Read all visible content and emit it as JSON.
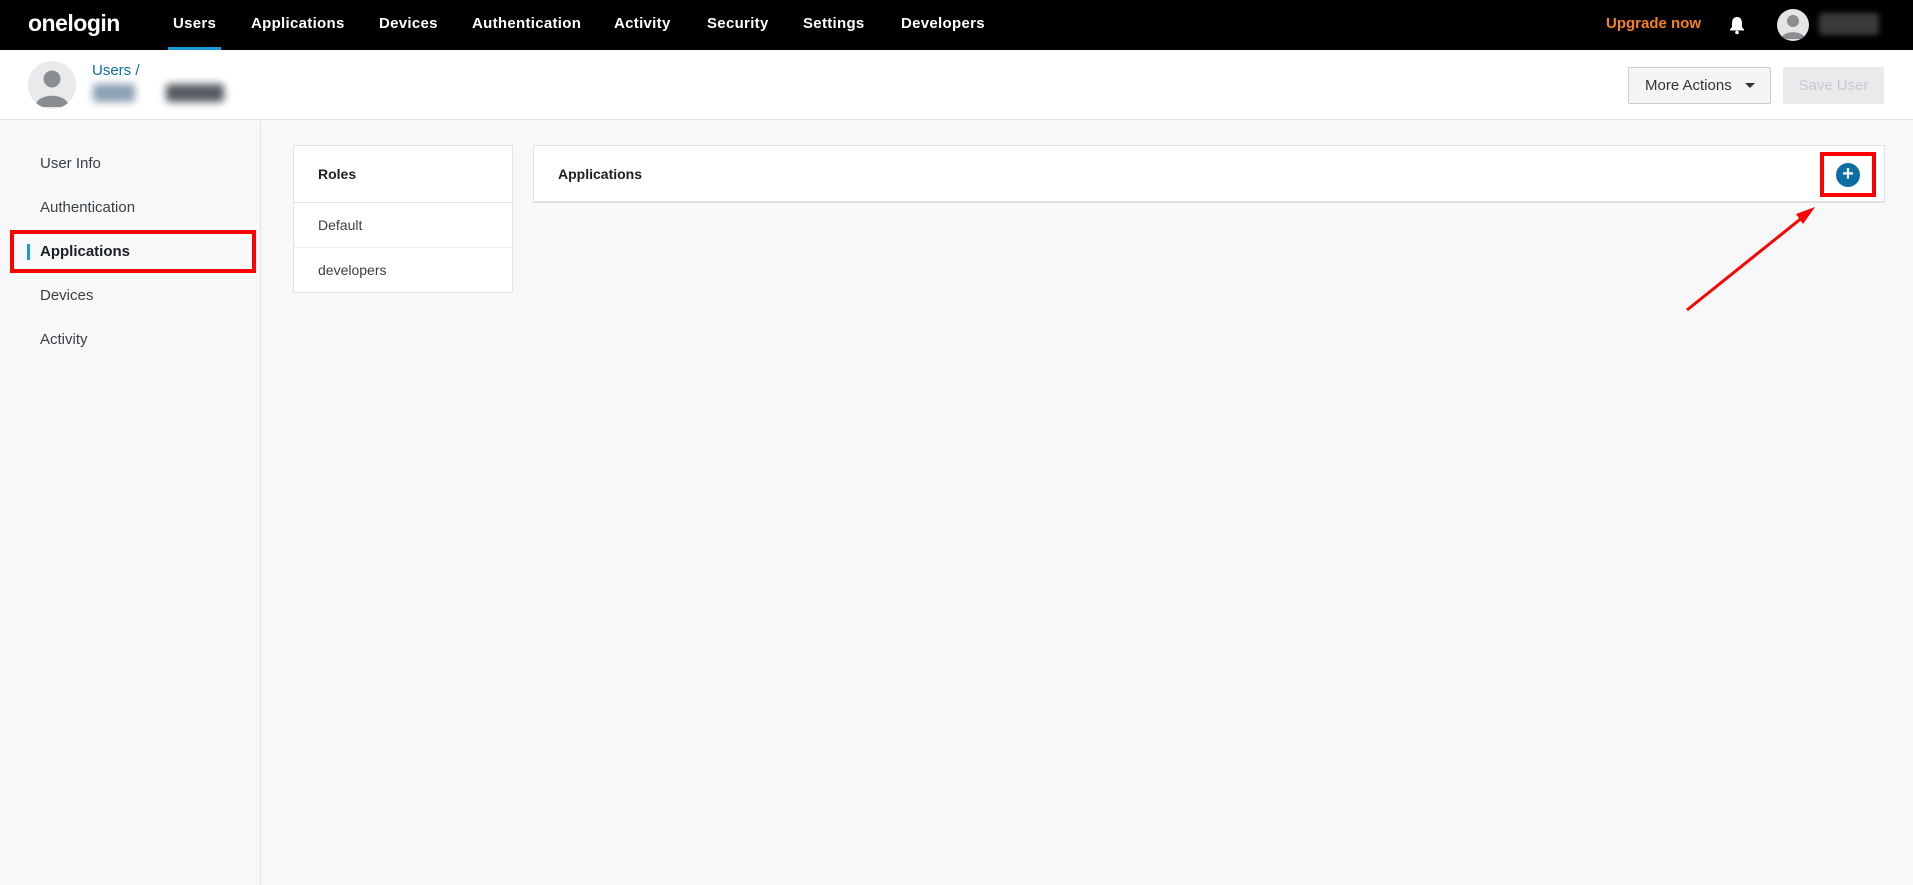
{
  "nav": {
    "logo": "onelogin",
    "items": [
      "Users",
      "Applications",
      "Devices",
      "Authentication",
      "Activity",
      "Security",
      "Settings",
      "Developers"
    ],
    "active": "Users",
    "upgrade": "Upgrade now",
    "icons": {
      "notifications": "bell-icon",
      "profile": "user-avatar-icon"
    }
  },
  "header": {
    "breadcrumb": "Users /",
    "user_name": "",
    "more_actions": "More Actions",
    "save_user": "Save User"
  },
  "sidebar": {
    "items": [
      "User Info",
      "Authentication",
      "Applications",
      "Devices",
      "Activity"
    ],
    "active": "Applications"
  },
  "roles": {
    "title": "Roles",
    "rows": [
      "Default",
      "developers"
    ]
  },
  "applications": {
    "title": "Applications",
    "add_icon": "plus-circle-icon"
  },
  "colors": {
    "topbar": "#000000",
    "accent": "#1a9bd7",
    "upgrade": "#f58220",
    "link": "#0b6fa4",
    "annotation": "#ff0000"
  }
}
